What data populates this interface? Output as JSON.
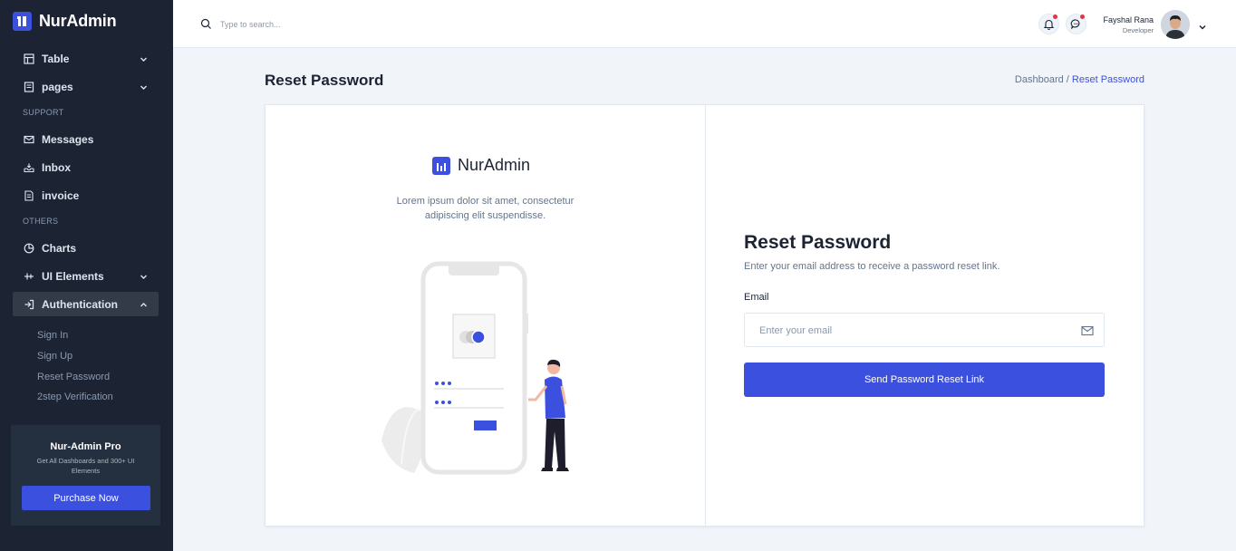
{
  "sidebar": {
    "brand": "NurAdmin",
    "items": [
      {
        "label": "Table",
        "icon": "table-icon"
      },
      {
        "label": "pages",
        "icon": "pages-icon"
      },
      {
        "label": "Messages",
        "icon": "envelope-icon"
      },
      {
        "label": "Inbox",
        "icon": "inbox-icon"
      },
      {
        "label": "invoice",
        "icon": "invoice-icon"
      },
      {
        "label": "Charts",
        "icon": "pie-chart-icon"
      },
      {
        "label": "UI Elements",
        "icon": "ui-elements-icon"
      },
      {
        "label": "Authentication",
        "icon": "login-icon"
      }
    ],
    "groups": {
      "support": "SUPPORT",
      "others": "OTHERS"
    },
    "auth_subitems": [
      "Sign In",
      "Sign Up",
      "Reset Password",
      "2step Verification"
    ],
    "promo": {
      "title": "Nur-Admin Pro",
      "text": "Get All Dashboards and 300+ UI Elements",
      "button": "Purchase Now"
    }
  },
  "header": {
    "search_placeholder": "Type to search...",
    "user": {
      "name": "Fayshal Rana",
      "role": "Developer"
    }
  },
  "main": {
    "page_title": "Reset Password",
    "breadcrumb": {
      "parent": "Dashboard /",
      "current": "Reset Password"
    }
  },
  "card": {
    "logo_text": "NurAdmin",
    "description": "Lorem ipsum dolor sit amet, consectetur adipiscing elit suspendisse.",
    "form": {
      "title": "Reset Password",
      "subtitle": "Enter your email address to receive a password reset link.",
      "email_label": "Email",
      "email_placeholder": "Enter your email",
      "email_value": "",
      "submit": "Send Password Reset Link"
    }
  },
  "colors": {
    "sidebar_bg": "#1c2434",
    "primary": "#3c50e0",
    "page_bg": "#f1f5f9",
    "notification_dot": "#dc3545"
  }
}
